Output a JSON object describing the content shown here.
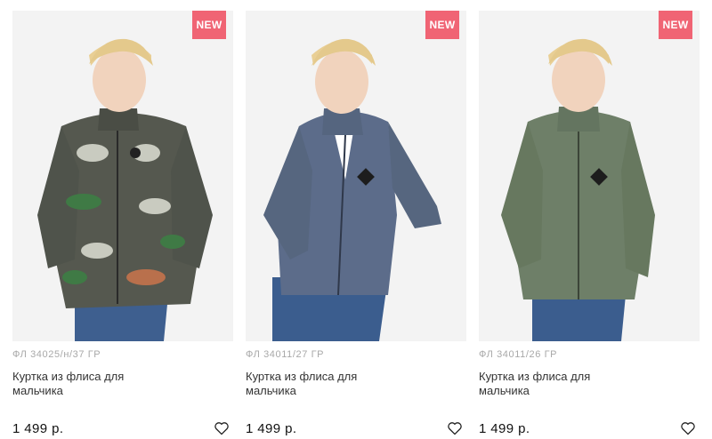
{
  "products": [
    {
      "badge": "NEW",
      "sku": "ФЛ 34025/н/37 ГР",
      "title": "Куртка из флиса для мальчика",
      "price": "1 499 р.",
      "jacket_color": "#55584f",
      "favorite_icon": "heart-outline-icon"
    },
    {
      "badge": "NEW",
      "sku": "ФЛ 34011/27 ГР",
      "title": "Куртка из флиса для мальчика",
      "price": "1 499 р.",
      "jacket_color": "#5c6c8a",
      "favorite_icon": "heart-outline-icon"
    },
    {
      "badge": "NEW",
      "sku": "ФЛ 34011/26 ГР",
      "title": "Куртка из флиса для мальчика",
      "price": "1 499 р.",
      "jacket_color": "#6e7f68",
      "favorite_icon": "heart-outline-icon"
    }
  ],
  "colors": {
    "badge_bg": "#f06474",
    "sku_text": "#a8a8a8",
    "photo_bg": "#f3f3f3"
  }
}
